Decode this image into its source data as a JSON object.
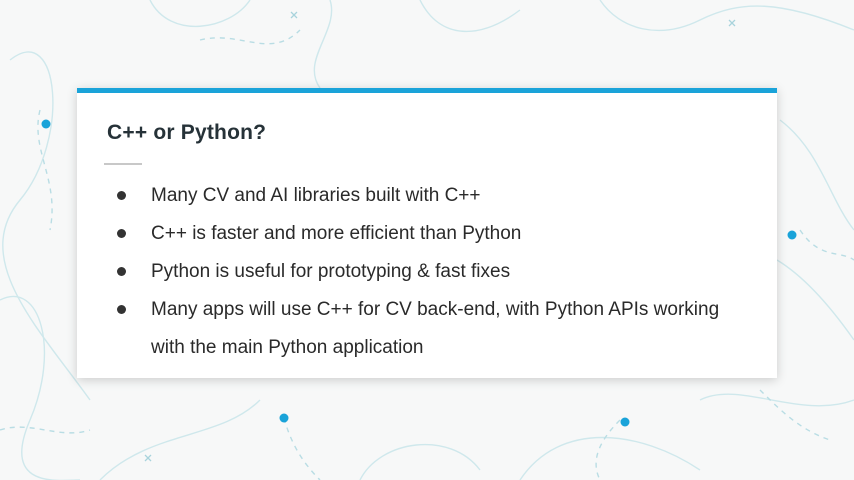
{
  "slide": {
    "title": "C++ or Python?",
    "bullets": [
      "Many CV and AI libraries built with C++",
      "C++ is faster and more efficient than Python",
      "Python is useful for prototyping & fast fixes",
      "Many apps will use C++ for CV back-end, with Python APIs working with the main Python application"
    ]
  },
  "colors": {
    "accent": "#1aa3d9",
    "background": "#f7f8f8",
    "card": "#ffffff",
    "title_text": "#263238",
    "body_text": "#2a2a2a"
  }
}
